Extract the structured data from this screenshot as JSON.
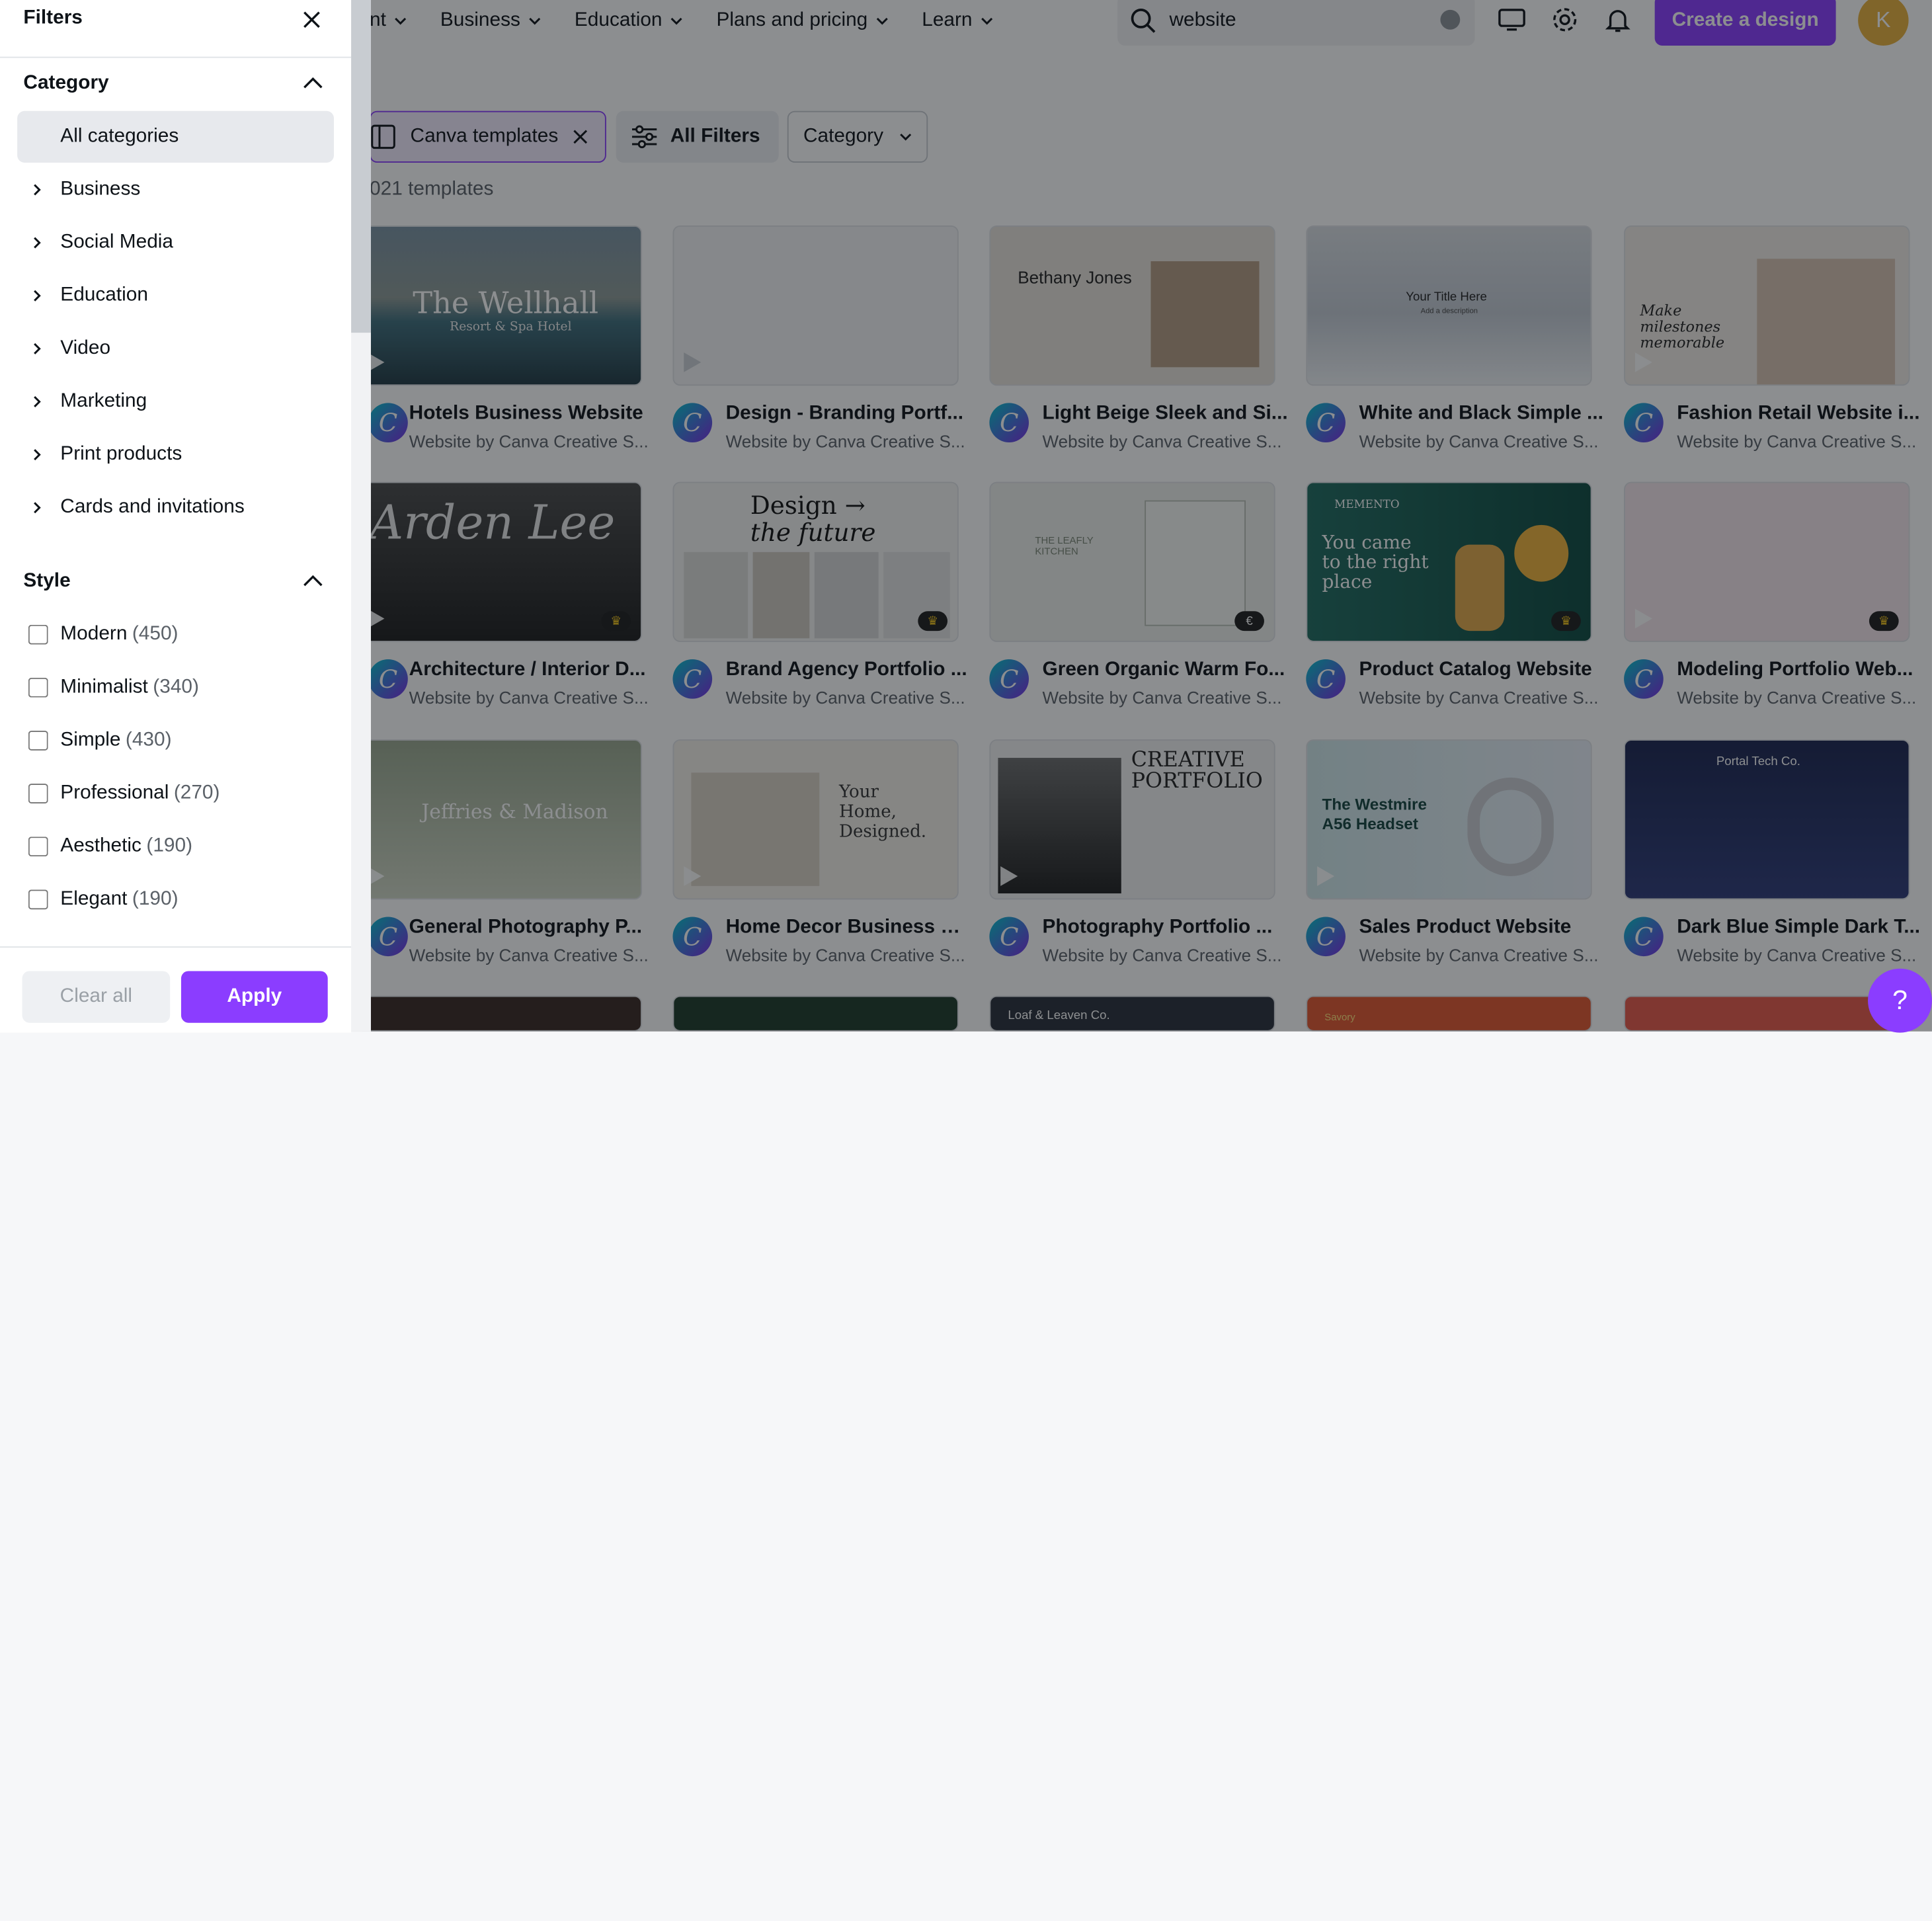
{
  "nav": {
    "items": [
      {
        "label": "nt"
      },
      {
        "label": "Business"
      },
      {
        "label": "Education"
      },
      {
        "label": "Plans and pricing"
      },
      {
        "label": "Learn"
      }
    ]
  },
  "search": {
    "value": "website"
  },
  "header": {
    "create_label": "Create a design",
    "avatar_initial": "K"
  },
  "toolbar": {
    "templates_chip": "Canva templates",
    "all_filters": "All Filters",
    "category": "Category"
  },
  "results": {
    "count_text": "021 templates"
  },
  "cards": [
    {
      "title": "Hotels Business Website",
      "author": "Website by Canva Creative S..."
    },
    {
      "title": "Design - Branding Portf...",
      "author": "Website by Canva Creative S..."
    },
    {
      "title": "Light Beige Sleek and Si...",
      "author": "Website by Canva Creative S..."
    },
    {
      "title": "White and Black Simple ...",
      "author": "Website by Canva Creative S..."
    },
    {
      "title": "Fashion Retail Website i...",
      "author": "Website by Canva Creative S..."
    },
    {
      "title": "Architecture / Interior D...",
      "author": "Website by Canva Creative S..."
    },
    {
      "title": "Brand Agency Portfolio ...",
      "author": "Website by Canva Creative S..."
    },
    {
      "title": "Green Organic Warm Fo...",
      "author": "Website by Canva Creative S..."
    },
    {
      "title": "Product Catalog Website",
      "author": "Website by Canva Creative S..."
    },
    {
      "title": "Modeling Portfolio Web...",
      "author": "Website by Canva Creative S..."
    },
    {
      "title": "General Photography P...",
      "author": "Website by Canva Creative S..."
    },
    {
      "title": "Home Decor Business W...",
      "author": "Website by Canva Creative S..."
    },
    {
      "title": "Photography Portfolio ...",
      "author": "Website by Canva Creative S..."
    },
    {
      "title": "Sales Product Website",
      "author": "Website by Canva Creative S..."
    },
    {
      "title": "Dark Blue Simple Dark T...",
      "author": "Website by Canva Creative S..."
    }
  ],
  "thumb_text": {
    "wellhall": "The Wellhall",
    "wellhall_sub": "Resort & Spa Hotel",
    "bethany": "Bethany Jones",
    "title_here": "Your Title Here",
    "add_desc": "Add a description",
    "milestones": "Make milestones memorable",
    "arden": "Arden Lee",
    "design_future_1": "Design →",
    "design_future_2": "the future",
    "leafly": "THE LEAFLY KITCHEN",
    "memento": "MEMENTO",
    "came": "You came to the right place",
    "jeffries": "Jeffries & Madison",
    "home_designed": "Your Home, Designed.",
    "creative": "CREATIVE PORTFOLIO",
    "westmire": "The Westmire A56 Headset",
    "portal": "Portal Tech Co.",
    "loaf": "Loaf & Leaven Co.",
    "savory": "Savory"
  },
  "filters": {
    "title": "Filters",
    "category_title": "Category",
    "all_categories": "All categories",
    "categories": [
      {
        "label": "Business"
      },
      {
        "label": "Social Media"
      },
      {
        "label": "Education"
      },
      {
        "label": "Video"
      },
      {
        "label": "Marketing"
      },
      {
        "label": "Print products"
      },
      {
        "label": "Cards and invitations"
      }
    ],
    "style_title": "Style",
    "styles": [
      {
        "label": "Modern",
        "count": "(450)"
      },
      {
        "label": "Minimalist",
        "count": "(340)"
      },
      {
        "label": "Simple",
        "count": "(430)"
      },
      {
        "label": "Professional",
        "count": "(270)"
      },
      {
        "label": "Aesthetic",
        "count": "(190)"
      },
      {
        "label": "Elegant",
        "count": "(190)"
      }
    ],
    "clear_label": "Clear all",
    "apply_label": "Apply"
  },
  "help": {
    "label": "?"
  },
  "colors": {
    "accent": "#8b3dff",
    "avatar": "#e9b03c",
    "overlay": "rgba(14,19,24,0.48)"
  }
}
